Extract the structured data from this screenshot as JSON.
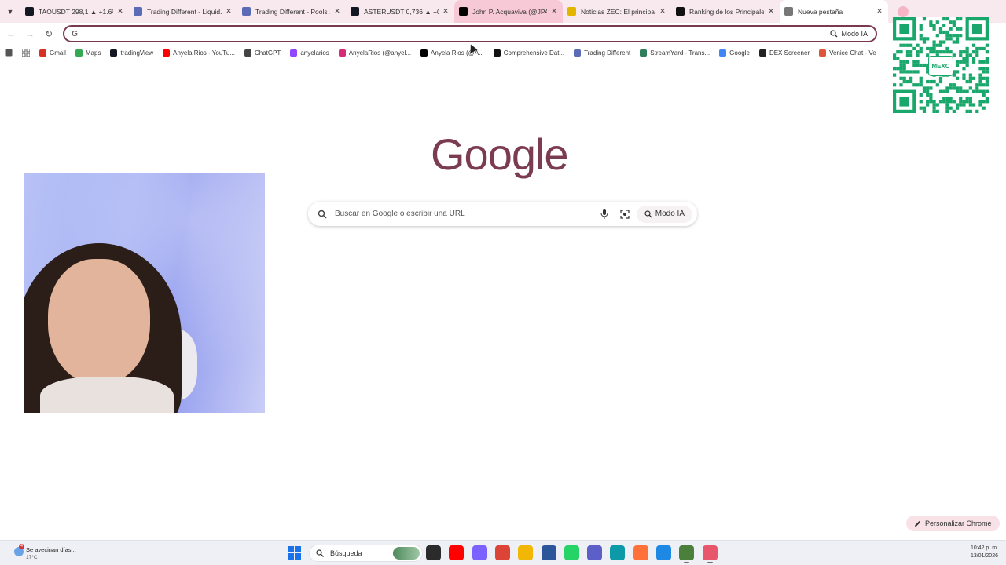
{
  "tabs": [
    {
      "title": "TAOUSDT 298,1 ▲ +1.6%",
      "icon": "tradingview-icon",
      "color": "#131722",
      "state": "normal"
    },
    {
      "title": "Trading Different - Liquid...",
      "icon": "globe-icon",
      "color": "#5b6bb5",
      "state": "normal"
    },
    {
      "title": "Trading Different - Pools ...",
      "icon": "globe-icon",
      "color": "#5b6bb5",
      "state": "normal"
    },
    {
      "title": "ASTERUSDT 0,736 ▲ +0.9",
      "icon": "tradingview-icon",
      "color": "#131722",
      "state": "normal"
    },
    {
      "title": "John P. Acquaviva (@JPA/",
      "icon": "x-icon",
      "color": "#000000",
      "state": "hover"
    },
    {
      "title": "Noticias ZEC: El principal",
      "icon": "news-icon",
      "color": "#e3b400",
      "state": "normal"
    },
    {
      "title": "Ranking de los Principale",
      "icon": "bookmark-icon",
      "color": "#111111",
      "state": "normal"
    },
    {
      "title": "Nueva pestaña",
      "icon": "chrome-icon",
      "color": "#777777",
      "state": "active"
    }
  ],
  "toolbar": {
    "omnibox_value": "",
    "omnibox_ai_label": "Modo IA"
  },
  "bookmarks": [
    {
      "label": "Gmail",
      "icon": "gmail-icon",
      "color": "#d93025"
    },
    {
      "label": "Maps",
      "icon": "maps-icon",
      "color": "#34a853"
    },
    {
      "label": "tradingView",
      "icon": "tradingview-icon",
      "color": "#131722"
    },
    {
      "label": "Anyela Rios - YouTu...",
      "icon": "youtube-icon",
      "color": "#ff0000"
    },
    {
      "label": "ChatGPT",
      "icon": "chatgpt-icon",
      "color": "#444444"
    },
    {
      "label": "anyelarios",
      "icon": "twitch-icon",
      "color": "#9146ff"
    },
    {
      "label": "AnyelaRios (@anyel...",
      "icon": "instagram-icon",
      "color": "#d62976"
    },
    {
      "label": "Anyela Rios (@A...",
      "icon": "x-icon",
      "color": "#000000"
    },
    {
      "label": "Comprehensive Dat...",
      "icon": "bookmark-icon",
      "color": "#111111"
    },
    {
      "label": "Trading Different",
      "icon": "globe-icon",
      "color": "#5b6bb5"
    },
    {
      "label": "StreamYard - Trans...",
      "icon": "streamyard-icon",
      "color": "#2e7d5b"
    },
    {
      "label": "Google",
      "icon": "google-icon",
      "color": "#4285f4"
    },
    {
      "label": "DEX Screener",
      "icon": "dexscreener-icon",
      "color": "#222222"
    },
    {
      "label": "Venice Chat - Ve",
      "icon": "venice-icon",
      "color": "#e0533b"
    }
  ],
  "main": {
    "logo_text": "Google",
    "search_placeholder": "Buscar en Google o escribir una URL",
    "ai_mode_label": "Modo IA",
    "customize_label": "Personalizar Chrome"
  },
  "qr": {
    "badge_text": "MEXC"
  },
  "taskbar": {
    "weather_text": "Se avecinan días...",
    "weather_temp": "17°C",
    "weather_badge": "4",
    "search_label": "Búsqueda",
    "time": "10:42 p. m.",
    "date": "13/01/2026",
    "apps": [
      {
        "icon": "file-explorer-dark-icon",
        "color": "#2b2b2b"
      },
      {
        "icon": "youtube-icon",
        "color": "#ff0000"
      },
      {
        "icon": "copilot-icon",
        "color": "#7b61ff"
      },
      {
        "icon": "chrome-icon",
        "color": "#db4437"
      },
      {
        "icon": "folder-icon",
        "color": "#f2b705"
      },
      {
        "icon": "word-icon",
        "color": "#2b579a"
      },
      {
        "icon": "whatsapp-icon",
        "color": "#25d366"
      },
      {
        "icon": "teams-icon",
        "color": "#5b5fc7"
      },
      {
        "icon": "edge-icon",
        "color": "#0c9aa8"
      },
      {
        "icon": "firefox-icon",
        "color": "#ff7139"
      },
      {
        "icon": "tradingview-app-icon",
        "color": "#1e88e5"
      },
      {
        "icon": "chrome-profile-icon",
        "color": "#4a7f3c"
      },
      {
        "icon": "chrome-profile2-icon",
        "color": "#e8566c"
      }
    ]
  }
}
